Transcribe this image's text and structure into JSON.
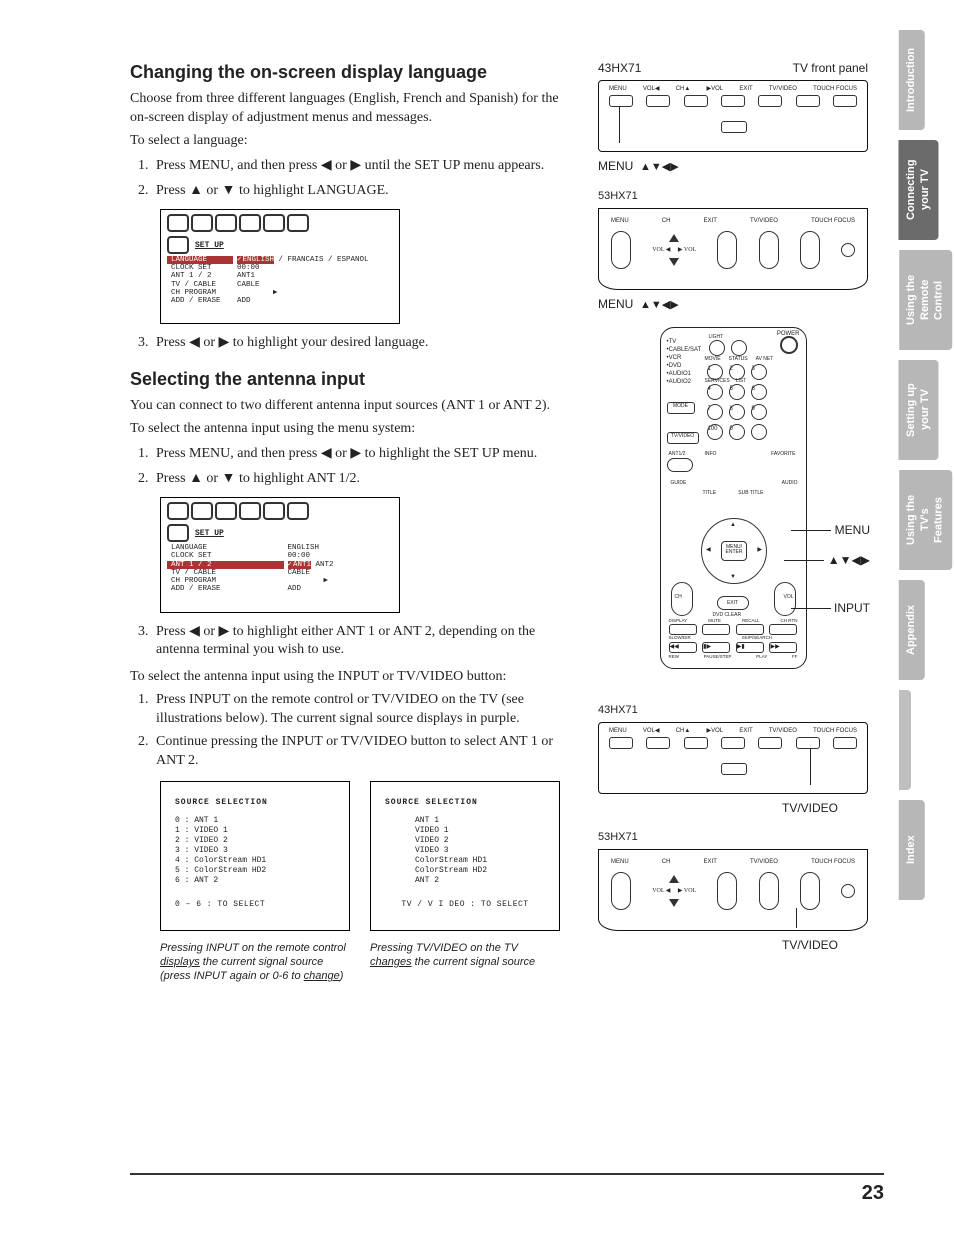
{
  "page_number": "23",
  "side_tabs": [
    "Introduction",
    "Connecting your TV",
    "Using the Remote Control",
    "Setting up your TV",
    "Using the TV's Features",
    "Appendix",
    "",
    "Index"
  ],
  "h1a": "Changing the on-screen display language",
  "p1a": "Choose from three different languages (English, French and Spanish) for the on-screen display of adjustment menus and messages.",
  "p1b": "To select a language:",
  "s1_li1_a": "Press MENU, and then press ",
  "s1_li1_b": " or ",
  "s1_li1_c": " until the SET UP menu appears.",
  "s1_li2_a": "Press ",
  "s1_li2_b": " or ",
  "s1_li2_c": " to highlight LANGUAGE.",
  "s1_li3_a": "Press ",
  "s1_li3_b": " or ",
  "s1_li3_c": " to highlight your desired language.",
  "osd_setup_label": "SET UP",
  "osd1": {
    "rows_left": [
      "LANGUAGE",
      "CLOCK SET",
      "ANT 1 / 2",
      "TV / CABLE",
      "CH PROGRAM",
      "ADD / ERASE"
    ],
    "rows_right": [
      "ENGLISH / FRANCAIS / ESPANOL",
      "00:00",
      "ANT1",
      "CABLE",
      "",
      "ADD"
    ],
    "highlight_row": 0,
    "highlight_val": "ENGLISH",
    "chk_row": 0
  },
  "osd2": {
    "rows_left": [
      "LANGUAGE",
      "CLOCK SET",
      "ANT 1 / 2",
      "TV / CABLE",
      "CH PROGRAM",
      "ADD / ERASE"
    ],
    "rows_right": [
      "ENGLISH",
      "00:00",
      "ANT1  ANT2",
      "CABLE",
      "",
      "ADD"
    ],
    "highlight_row": 2,
    "highlight_val": "ANT1",
    "chk_row": 2
  },
  "h1b": "Selecting the antenna input",
  "p2a": "You can connect to two different antenna input sources (ANT 1 or ANT 2).",
  "p2b": "To select the antenna input using the menu system:",
  "s2_li1_a": "Press MENU, and then press ",
  "s2_li1_b": " or ",
  "s2_li1_c": " to highlight the SET UP menu.",
  "s2_li2_a": "Press ",
  "s2_li2_b": " or ",
  "s2_li2_c": " to highlight ANT 1/2.",
  "s2_li3_a": "Press ",
  "s2_li3_b": " or ",
  "s2_li3_c": " to highlight either ANT 1 or ANT 2, depending on the antenna terminal you wish to use.",
  "p2c": "To select the antenna input using the INPUT or TV/VIDEO button:",
  "s3_li1": "Press INPUT on the remote control or TV/VIDEO on the TV (see illustrations below). The current signal source displays in purple.",
  "s3_li2": "Continue pressing the INPUT or TV/VIDEO button to select ANT 1 or ANT 2.",
  "src_title": "SOURCE SELECTION",
  "src_left_lines": [
    "0 : ANT 1",
    "1 : VIDEO 1",
    "2 : VIDEO 2",
    "3 : VIDEO 3",
    "4 : ColorStream HD1",
    "5 : ColorStream HD2",
    "6 : ANT 2"
  ],
  "src_left_foot": "0 – 6 : TO SELECT",
  "src_right_lines": [
    "ANT 1",
    "VIDEO 1",
    "VIDEO 2",
    "VIDEO 3",
    "ColorStream HD1",
    "ColorStream HD2",
    "ANT 2"
  ],
  "src_right_foot": "TV / V I DEO : TO SELECT",
  "cap_left_a": "Pressing INPUT on the remote control ",
  "cap_left_u1": "displays",
  "cap_left_b": " the current signal source (press INPUT again or 0-6 to ",
  "cap_left_u2": "change",
  "cap_left_c": ")",
  "cap_right_a": "Pressing TV/VIDEO on the TV ",
  "cap_right_u1": "changes",
  "cap_right_b": " the current signal source",
  "modelA": "43HX71",
  "modelB": "53HX71",
  "tvfront": "TV front panel",
  "panel_btn_labels": [
    "MENU",
    "VOL◀",
    "CH▲",
    "▶VOL",
    "EXIT",
    "TV/VIDEO",
    "TOUCH FOCUS"
  ],
  "panel_btn_labels_b": [
    "MENU",
    "VOL",
    "CH",
    "VOL",
    "EXIT",
    "TV/VIDEO",
    "TOUCH FOCUS"
  ],
  "menu_word": "MENU",
  "arrows_all": "▲▼◀▶",
  "input_word": "INPUT",
  "tvvideo_word": "TV/VIDEO",
  "remote_side_labels": [
    "TV",
    "CABLE/SAT",
    "VCR",
    "DVD",
    "AUDIO1",
    "AUDIO2"
  ],
  "remote_top_labels": [
    "LIGHT",
    "MOVIE",
    "STATUS",
    "AV NET",
    "SERVICES",
    "LIST"
  ],
  "remote_mode": "MODE",
  "remote_tvv": "TV/VIDEO",
  "remote_ant": "ANT1/2",
  "remote_info": "INFO",
  "remote_fav": "FAVORITE",
  "remote_guide": "GUIDE",
  "remote_title": "TITLE",
  "remote_sub": "SUB TITLE",
  "remote_aud": "AUDIO",
  "remote_menu_center": "MENU/\nENTER",
  "remote_ch": "CH",
  "remote_vol": "VOL",
  "remote_exit": "EXIT",
  "remote_dvd": "DVD CLEAR",
  "remote_bottom1": [
    "DISPLAY",
    "MUTE",
    "RECALL",
    "CH RTN"
  ],
  "remote_bottom2": [
    "SLOW/DIR",
    "",
    "SKIP/SEARCH",
    ""
  ],
  "remote_transport": [
    "REW",
    "PAUSE/STEP",
    "PLAY",
    "FF"
  ],
  "remote_power": "POWER"
}
